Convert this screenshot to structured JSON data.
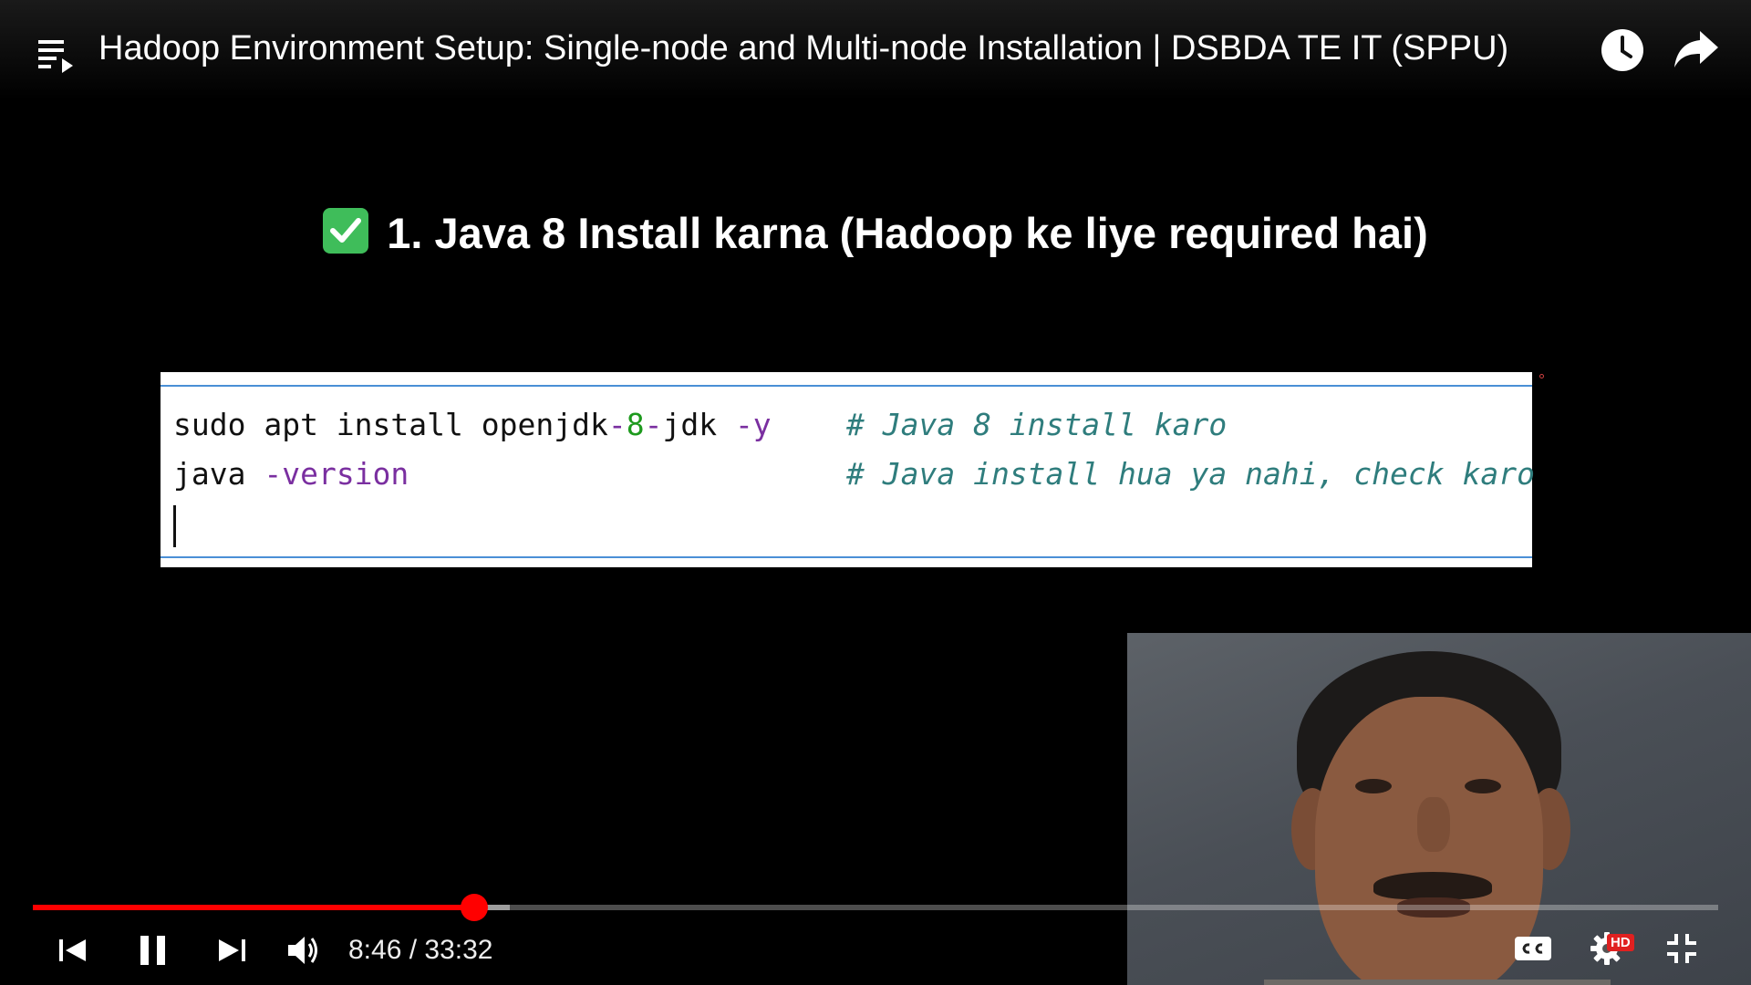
{
  "header": {
    "title": "Hadoop Environment Setup: Single-node and Multi-node Installation | DSBDA TE IT (SPPU)",
    "icons": [
      "playlist-icon",
      "watch-later-icon",
      "share-icon"
    ]
  },
  "slide": {
    "heading_icon": "check-mark-icon",
    "heading": "1. Java 8 Install karna (Hadoop ke liye required hai)",
    "code": {
      "line1": {
        "cmd": "sudo apt install openjdk",
        "dash1": "-",
        "num": "8",
        "dash2": "-",
        "rest": "jdk ",
        "opt": "-y",
        "comment": "# Java 8 install karo"
      },
      "line2": {
        "cmd": "java ",
        "opt": "-version",
        "comment": "# Java install hua ya nahi, check karo"
      }
    }
  },
  "player": {
    "current_time": "8:46",
    "separator": " / ",
    "duration": "33:32",
    "progress_fraction": 0.262,
    "buffered_fraction": 0.283,
    "controls": [
      "previous-icon",
      "pause-icon",
      "next-icon",
      "volume-icon",
      "cc-icon",
      "settings-icon",
      "exit-fullscreen-icon"
    ],
    "quality_badge": "HD",
    "colors": {
      "played": "#ff0000",
      "badge": "#e02020"
    }
  }
}
